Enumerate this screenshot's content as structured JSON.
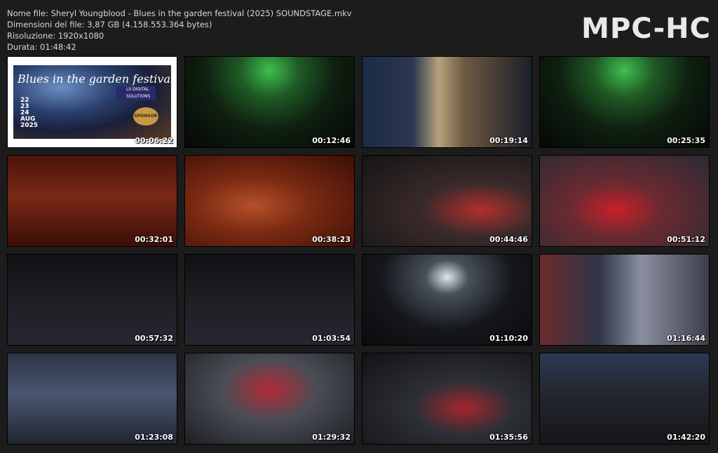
{
  "file_info": {
    "name_line": "Nome file: Sheryl Youngblood - Blues in the garden festival (2025) SOUNDSTAGE.mkv",
    "size_line": "Dimensioni del file: 3,87 GB (4.158.553.364 bytes)",
    "resolution_line": "Risoluzione: 1920x1080",
    "duration_line": "Durata: 01:48:42"
  },
  "brand": "MPC-HC",
  "poster": {
    "title": "Blues in the garden festival",
    "dates": [
      "22",
      "23",
      "24",
      "AUG",
      "2025"
    ],
    "sponsor": "SPONSOR",
    "logo_text": "LS DIGITAL SOLUTIONS"
  },
  "thumbnails": [
    {
      "timestamp": "00:06:22",
      "scene": "poster"
    },
    {
      "timestamp": "00:12:46",
      "scene": "green-stage"
    },
    {
      "timestamp": "00:19:14",
      "scene": "guitarist-closeup"
    },
    {
      "timestamp": "00:25:35",
      "scene": "green-stage"
    },
    {
      "timestamp": "00:32:01",
      "scene": "red-keyboard"
    },
    {
      "timestamp": "00:38:23",
      "scene": "red-singer"
    },
    {
      "timestamp": "00:44:46",
      "scene": "drummer"
    },
    {
      "timestamp": "00:51:12",
      "scene": "singer-red-dress"
    },
    {
      "timestamp": "00:57:32",
      "scene": "crowd"
    },
    {
      "timestamp": "01:03:54",
      "scene": "crowd"
    },
    {
      "timestamp": "01:10:20",
      "scene": "wide-stage"
    },
    {
      "timestamp": "01:16:44",
      "scene": "band-keys"
    },
    {
      "timestamp": "01:23:08",
      "scene": "keyboardist"
    },
    {
      "timestamp": "01:29:32",
      "scene": "drummer-closeup"
    },
    {
      "timestamp": "01:35:56",
      "scene": "stage-players"
    },
    {
      "timestamp": "01:42:20",
      "scene": "full-band"
    }
  ],
  "colors": {
    "background": "#1c1c1c",
    "text": "#d7d7d7",
    "brand": "#e9e9e9"
  }
}
